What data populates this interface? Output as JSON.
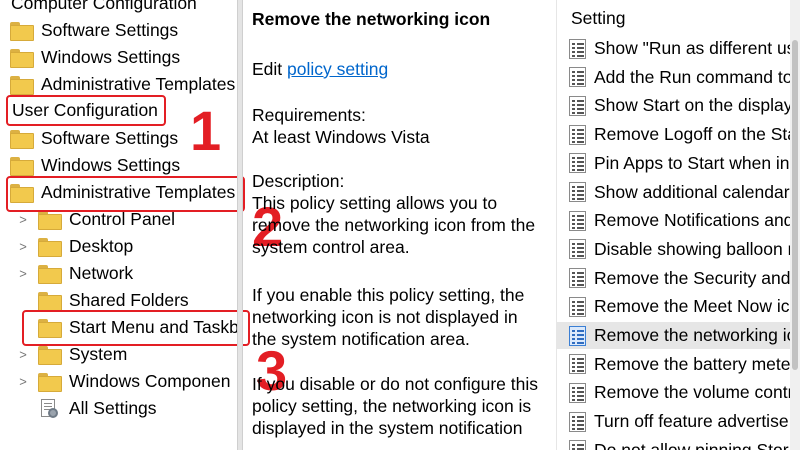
{
  "tree": {
    "items": [
      {
        "label": "Computer Configuration",
        "kind": "root"
      },
      {
        "label": "Software Settings",
        "kind": "folder"
      },
      {
        "label": "Windows Settings",
        "kind": "folder"
      },
      {
        "label": "Administrative Templates",
        "kind": "folder"
      },
      {
        "label": "User Configuration",
        "kind": "root"
      },
      {
        "label": "Software Settings",
        "kind": "folder"
      },
      {
        "label": "Windows Settings",
        "kind": "folder"
      },
      {
        "label": "Administrative Templates",
        "kind": "folder"
      },
      {
        "label": "Control Panel",
        "kind": "folder",
        "expander": ">"
      },
      {
        "label": "Desktop",
        "kind": "folder",
        "expander": ">"
      },
      {
        "label": "Network",
        "kind": "folder",
        "expander": ">"
      },
      {
        "label": "Shared Folders",
        "kind": "folder"
      },
      {
        "label": "Start Menu and Taskb",
        "kind": "folder"
      },
      {
        "label": "System",
        "kind": "folder",
        "expander": ">"
      },
      {
        "label": "Windows Componen",
        "kind": "folder",
        "expander": ">"
      },
      {
        "label": "All Settings",
        "kind": "settings"
      }
    ]
  },
  "annotations": {
    "step1": "1",
    "step2": "2",
    "step3": "3",
    "color": "#e31e24"
  },
  "description": {
    "title": "Remove the networking icon",
    "edit_prefix": "Edit ",
    "edit_link": "policy setting ",
    "requirements_label": "Requirements:",
    "requirements_value": "At least Windows Vista",
    "description_label": "Description:",
    "lines": [
      "This policy setting allows you to",
      "remove the networking icon from the",
      "system control area.",
      "",
      "If you enable this policy setting, the",
      "networking icon is not displayed in",
      "the system notification area.",
      "",
      "If you disable or do not configure this",
      "policy setting, the networking icon is",
      "displayed in the system notification"
    ]
  },
  "settings_list": {
    "header": "Setting",
    "items": [
      "Show \"Run as different use",
      "Add the Run command to",
      "Show Start on the display",
      "Remove Logoff on the Sta",
      "Pin Apps to Start when ins",
      "Show additional calendar",
      "Remove Notifications and",
      "Disable showing balloon n",
      "Remove the Security and M",
      "Remove the Meet Now ico",
      "Remove the networking ic",
      "Remove the battery meter",
      "Remove the volume contro",
      "Turn off feature advertise",
      "Do not allow pinning Stor"
    ],
    "selected_index": 10
  },
  "colors": {
    "link": "#0066cc",
    "selection": "#e6e6e6",
    "folder": "#f2c94d"
  }
}
